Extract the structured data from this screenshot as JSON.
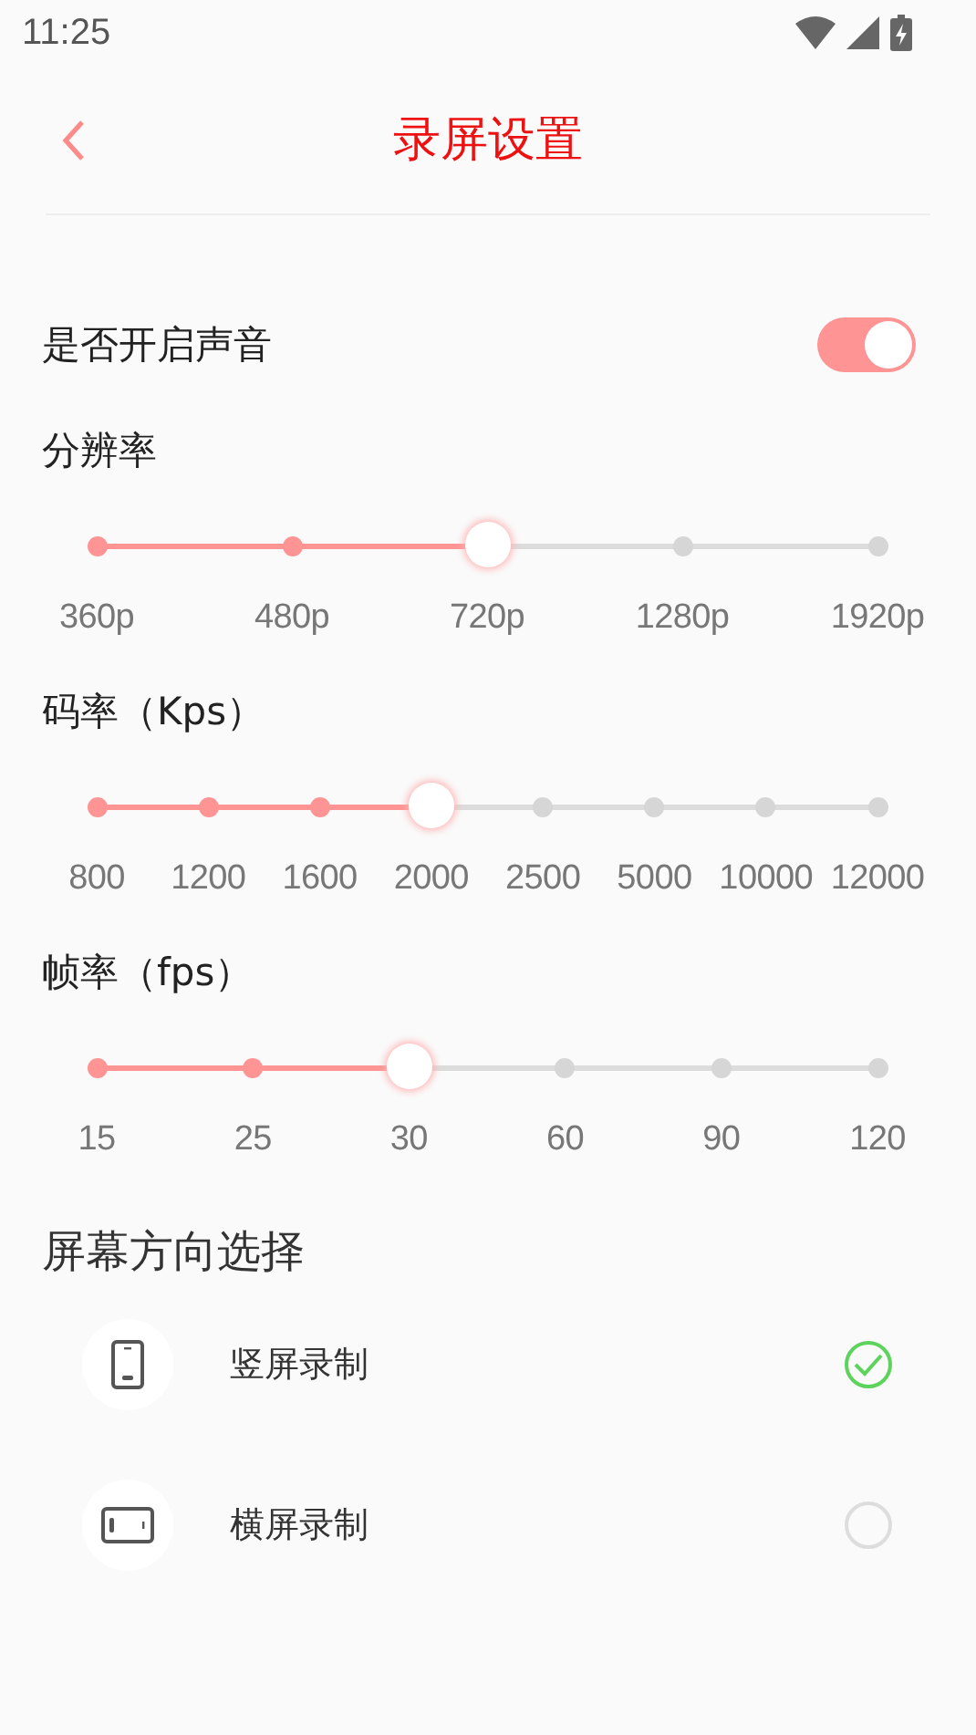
{
  "status_bar": {
    "time": "11:25"
  },
  "header": {
    "title": "录屏设置"
  },
  "sound": {
    "label": "是否开启声音",
    "on": true
  },
  "sliders": [
    {
      "label": "分辨率",
      "level": 0.5,
      "ticks": [
        "360p",
        "480p",
        "720p",
        "1280p",
        "1920p"
      ]
    },
    {
      "label": "码率（Kps）",
      "level": 0.4286,
      "ticks": [
        "800",
        "1200",
        "1600",
        "2000",
        "2500",
        "5000",
        "10000",
        "12000"
      ]
    },
    {
      "label": "帧率（fps）",
      "level": 0.4,
      "ticks": [
        "15",
        "25",
        "30",
        "60",
        "90",
        "120"
      ]
    }
  ],
  "orientation": {
    "title": "屏幕方向选择",
    "options": [
      {
        "kind": "portrait",
        "label": "竖屏录制",
        "selected": true
      },
      {
        "kind": "landscape",
        "label": "横屏录制",
        "selected": false
      }
    ]
  }
}
